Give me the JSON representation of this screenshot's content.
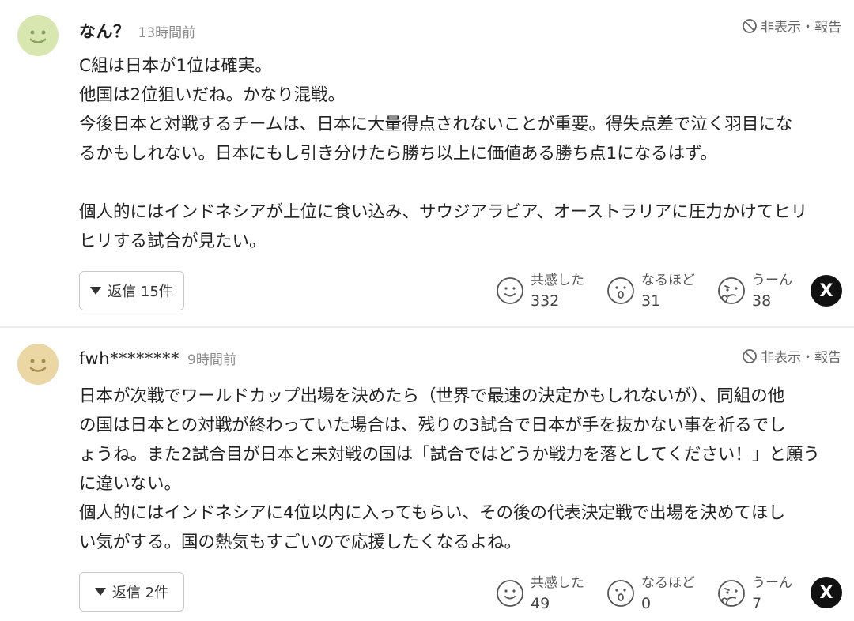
{
  "comments": [
    {
      "author": "なん？",
      "time": "13時間前",
      "hide_report": "非表示・報告",
      "lines": [
        "C組は日本が1位は確実。",
        "他国は2位狙いだね。かなり混戦。",
        "今後日本と対戦するチームは、日本に大量得点されないことが重要。得失点差で泣く羽目にな",
        "るかもしれない。日本にもし引き分けたら勝ち以上に価値ある勝ち点1になるはず。",
        "",
        "個人的にはインドネシアが上位に食い込み、サウジアラビア、オーストラリアに圧力かけてヒリ",
        "ヒリする試合が見たい。"
      ],
      "reply_label": "返信 15件",
      "reactions": [
        {
          "label": "共感した",
          "count": "332"
        },
        {
          "label": "なるほど",
          "count": "31"
        },
        {
          "label": "うーん",
          "count": "38"
        }
      ],
      "share": "X"
    },
    {
      "author": "fwh********",
      "time": "9時間前",
      "hide_report": "非表示・報告",
      "lines": [
        "日本が次戦でワールドカップ出場を決めたら（世界で最速の決定かもしれないが）、同組の他",
        "の国は日本との対戦が終わっていた場合は、残りの3試合で日本が手を抜かない事を祈るでし",
        "ょうね。また2試合目が日本と未対戦の国は「試合ではどうか戦力を落としてください！」と願う",
        "に違いない。",
        "個人的にはインドネシアに4位以内に入ってもらい、その後の代表決定戦で出場を決めてほし",
        "い気がする。国の熱気もすごいので応援したくなるよね。"
      ],
      "reply_label": "返信 2件",
      "reactions": [
        {
          "label": "共感した",
          "count": "49"
        },
        {
          "label": "なるほど",
          "count": "0"
        },
        {
          "label": "うーん",
          "count": "7"
        }
      ],
      "share": "X"
    }
  ],
  "icons": {
    "avatar": "smiley-face-icon",
    "hide": "no-entry-icon",
    "reply": "triangle-down-icon",
    "empathy": "smile-icon",
    "insight": "surprised-face-icon",
    "hmm": "thinking-face-icon",
    "share": "x-logo-icon"
  },
  "colors": {
    "avatar1": "#d8e7b0",
    "avatar2": "#ead7a3",
    "face_stroke": "#555555",
    "x_bg": "#111111"
  }
}
